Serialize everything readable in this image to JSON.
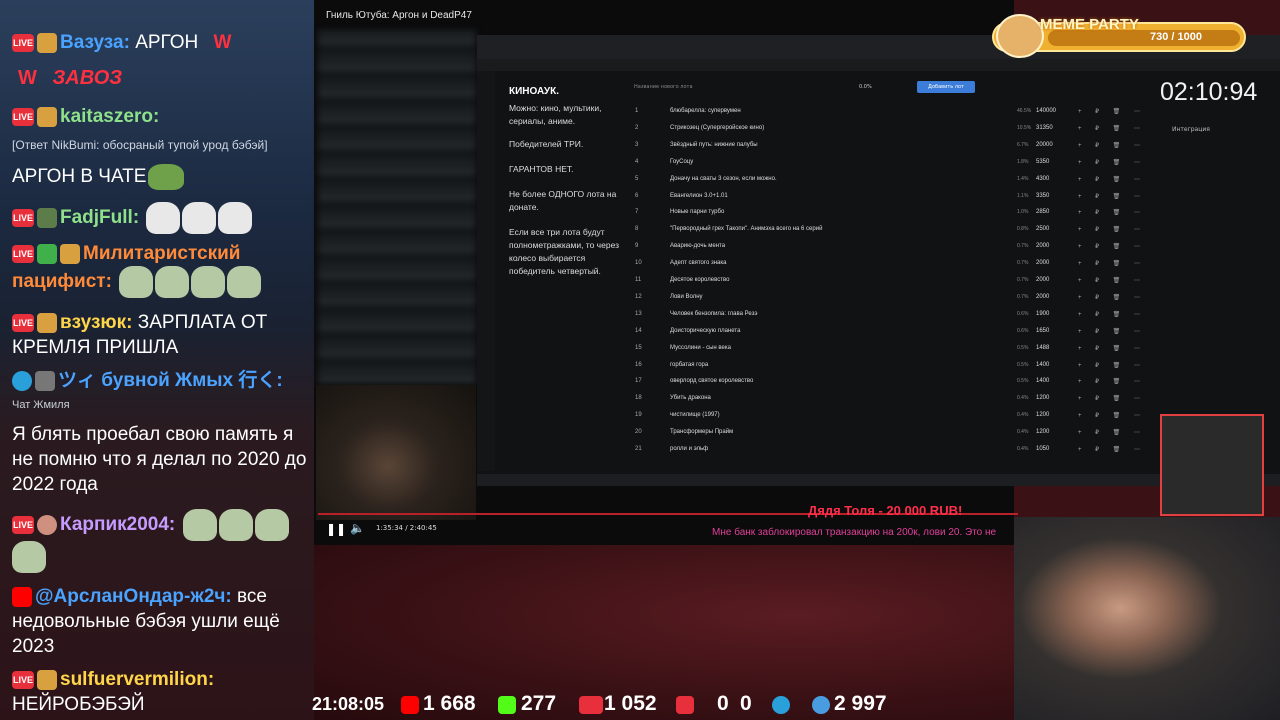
{
  "stream_title": "Гниль Ютуба: Аргон и DeadP47",
  "chat": [
    {
      "badge": "LIVE",
      "nick": "Вазуза:",
      "nick_color": "#4aa3ff",
      "text": "АРГОН",
      "extra": "W"
    },
    {
      "tag": "W",
      "tag2": "ЗАВОЗ"
    },
    {
      "badge": "LIVE",
      "nick": "kaitaszero:",
      "nick_color": "#8fe08a"
    },
    {
      "reply": "[Ответ NikBumi: обосраный тупой урод бэбэй]",
      "text": "АРГОН В ЧАТЕ"
    },
    {
      "badge": "LIVE",
      "nick": "FadjFull:",
      "nick_color": "#8fe08a"
    },
    {
      "badge": "LIVE",
      "nick": "Милитаристский пацифист:",
      "nick_color": "#ff8a3a"
    },
    {
      "badge": "LIVE",
      "nick": "взузюк:",
      "nick_color": "#ffd54a",
      "text": "ЗАРПЛАТА ОТ КРЕМЛЯ ПРИШЛА"
    },
    {
      "badge": "TG",
      "nick": "ツィ бувной Жмых 行く:",
      "nick_color": "#4aa3ff",
      "sub": "Чат Жмиля"
    },
    {
      "text": "Я блять проебал свою память я не помню что я делал по 2020 до 2022 года"
    },
    {
      "badge": "LIVE",
      "nick": "Карпик2004:",
      "nick_color": "#c89cff"
    },
    {
      "badge": "YT",
      "nick": "@АрсланОндар-ж2ч:",
      "nick_color": "#4aa3ff",
      "text": "все недовольные бэбэя ушли ещё 2023"
    },
    {
      "badge": "LIVE",
      "nick": "sulfuervermilion:",
      "nick_color": "#ffd54a",
      "text": "НЕЙРОБЭБЭЙ"
    }
  ],
  "browser": {
    "notes": {
      "heading": "КИНОАУК.",
      "lines": [
        "Можно: кино, мультики, сериалы, аниме.",
        "Победителей ТРИ.",
        "ГАРАНТОВ НЕТ.",
        "Не более ОДНОГО лота на донате.",
        "Если все три лота будут полнометражками, то через колесо выбирается победитель четвертый."
      ]
    },
    "search_placeholder": "Название нового лота",
    "percent": "0.0%",
    "add_button": "Добавить лот",
    "lots": [
      {
        "n": "1",
        "name": "блюбарелла: супервумен",
        "pct": "46.5%",
        "value": "140000"
      },
      {
        "n": "2",
        "name": "Стрикозец (Супергеройское кино)",
        "pct": "10.5%",
        "value": "31350"
      },
      {
        "n": "3",
        "name": "Звёздный путь: нижние палубы",
        "pct": "6.7%",
        "value": "20000"
      },
      {
        "n": "4",
        "name": "ГоуСоцу",
        "pct": "1.8%",
        "value": "5350"
      },
      {
        "n": "5",
        "name": "Доначу на сваты 3 сезон, если можно.",
        "pct": "1.4%",
        "value": "4300"
      },
      {
        "n": "6",
        "name": "Евангелион 3.0+1.01",
        "pct": "1.1%",
        "value": "3350"
      },
      {
        "n": "7",
        "name": "Новые парни турбо",
        "pct": "1.0%",
        "value": "2850"
      },
      {
        "n": "8",
        "name": "\"Первородный грех Такопи\". Анимэха всего на 6 серий",
        "pct": "0.8%",
        "value": "2500"
      },
      {
        "n": "9",
        "name": "Аварию-дочь мента",
        "pct": "0.7%",
        "value": "2000"
      },
      {
        "n": "10",
        "name": "Адепт святого знака",
        "pct": "0.7%",
        "value": "2000"
      },
      {
        "n": "11",
        "name": "Десятое королевство",
        "pct": "0.7%",
        "value": "2000"
      },
      {
        "n": "12",
        "name": "Лови Волну",
        "pct": "0.7%",
        "value": "2000"
      },
      {
        "n": "13",
        "name": "Человек бензопила: глава Резэ",
        "pct": "0.6%",
        "value": "1900"
      },
      {
        "n": "14",
        "name": "Доисторическую планета",
        "pct": "0.6%",
        "value": "1650"
      },
      {
        "n": "15",
        "name": "Муссолини - сын века",
        "pct": "0.5%",
        "value": "1488"
      },
      {
        "n": "16",
        "name": "горбатая гора",
        "pct": "0.5%",
        "value": "1400"
      },
      {
        "n": "17",
        "name": "оверлорд святое королевство",
        "pct": "0.5%",
        "value": "1400"
      },
      {
        "n": "18",
        "name": "Убить дракона",
        "pct": "0.4%",
        "value": "1200"
      },
      {
        "n": "19",
        "name": "чистилище (1997)",
        "pct": "0.4%",
        "value": "1200"
      },
      {
        "n": "20",
        "name": "Трансформеры Прайм",
        "pct": "0.4%",
        "value": "1200"
      },
      {
        "n": "21",
        "name": "ролли и эльф",
        "pct": "0.4%",
        "value": "1050"
      }
    ],
    "timer": "02:10:94",
    "integration_label": "Интеграция"
  },
  "video": {
    "time": "1:35:34 / 2:40:45"
  },
  "meme_party": {
    "title": "MEME PARTY",
    "count": "730 / 1000",
    "progress_fraction": 0.73
  },
  "donation": {
    "title": "Дядя Толя - 20 000 RUB!",
    "message": "Мне банк заблокировал транзакцию на 200к, лови 20. Это не"
  },
  "status": {
    "clock": "21:08:05",
    "youtube": "1 668",
    "kick": "277",
    "vk": "1 052",
    "rutube": "0",
    "r": "0",
    "viewers": "2 997"
  },
  "colors": {
    "youtube": "#ff0000",
    "kick": "#53fc18",
    "vk": "#e8303c",
    "telegram": "#2aa0da"
  }
}
